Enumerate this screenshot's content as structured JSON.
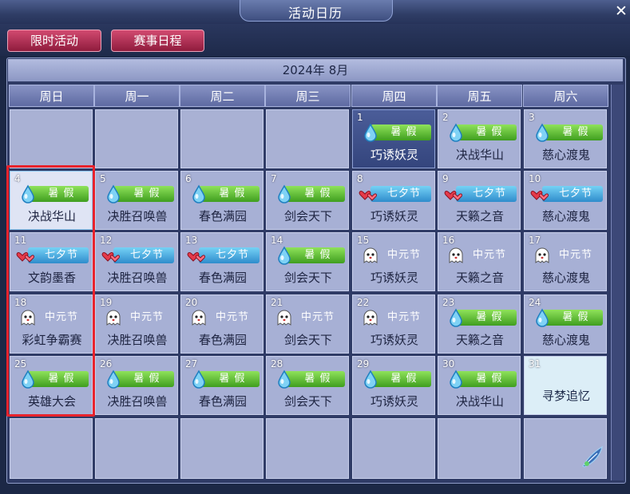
{
  "window": {
    "title": "活动日历",
    "close": "✕"
  },
  "tabs": [
    {
      "label": "限时活动"
    },
    {
      "label": "赛事日程"
    }
  ],
  "month": "2024年 8月",
  "weekdays": [
    "周日",
    "周一",
    "周二",
    "周三",
    "周四",
    "周五",
    "周六"
  ],
  "badges": {
    "summer": "暑 假",
    "qixi": "七夕节",
    "zhongyuan": "中元节"
  },
  "colors": {
    "summer": "#5bbf2e",
    "qixi": "#3aa0dc",
    "zhongyuan": "#b23a6c",
    "selection": "#e8232c"
  },
  "days": [
    {
      "d": "1",
      "badge": "summer",
      "event": "巧诱妖灵"
    },
    {
      "d": "2",
      "badge": "summer",
      "event": "决战华山"
    },
    {
      "d": "3",
      "badge": "summer",
      "event": "慈心渡鬼"
    },
    {
      "d": "4",
      "badge": "summer",
      "event": "决战华山"
    },
    {
      "d": "5",
      "badge": "summer",
      "event": "决胜召唤兽"
    },
    {
      "d": "6",
      "badge": "summer",
      "event": "春色满园"
    },
    {
      "d": "7",
      "badge": "summer",
      "event": "剑会天下"
    },
    {
      "d": "8",
      "badge": "qixi",
      "event": "巧诱妖灵"
    },
    {
      "d": "9",
      "badge": "qixi",
      "event": "天籁之音"
    },
    {
      "d": "10",
      "badge": "qixi",
      "event": "慈心渡鬼"
    },
    {
      "d": "11",
      "badge": "qixi",
      "event": "文韵墨香"
    },
    {
      "d": "12",
      "badge": "qixi",
      "event": "决胜召唤兽"
    },
    {
      "d": "13",
      "badge": "qixi",
      "event": "春色满园"
    },
    {
      "d": "14",
      "badge": "summer",
      "event": "剑会天下"
    },
    {
      "d": "15",
      "badge": "zhongyuan",
      "event": "巧诱妖灵"
    },
    {
      "d": "16",
      "badge": "zhongyuan",
      "event": "天籁之音"
    },
    {
      "d": "17",
      "badge": "zhongyuan",
      "event": "慈心渡鬼"
    },
    {
      "d": "18",
      "badge": "zhongyuan",
      "event": "彩虹争霸赛"
    },
    {
      "d": "19",
      "badge": "zhongyuan",
      "event": "决胜召唤兽"
    },
    {
      "d": "20",
      "badge": "zhongyuan",
      "event": "春色满园"
    },
    {
      "d": "21",
      "badge": "zhongyuan",
      "event": "剑会天下"
    },
    {
      "d": "22",
      "badge": "zhongyuan",
      "event": "巧诱妖灵"
    },
    {
      "d": "23",
      "badge": "summer",
      "event": "天籁之音"
    },
    {
      "d": "24",
      "badge": "summer",
      "event": "慈心渡鬼"
    },
    {
      "d": "25",
      "badge": "summer",
      "event": "英雄大会"
    },
    {
      "d": "26",
      "badge": "summer",
      "event": "决胜召唤兽"
    },
    {
      "d": "27",
      "badge": "summer",
      "event": "春色满园"
    },
    {
      "d": "28",
      "badge": "summer",
      "event": "剑会天下"
    },
    {
      "d": "29",
      "badge": "summer",
      "event": "巧诱妖灵"
    },
    {
      "d": "30",
      "badge": "summer",
      "event": "决战华山"
    },
    {
      "d": "31",
      "badge": "",
      "event": "寻梦追忆"
    }
  ]
}
